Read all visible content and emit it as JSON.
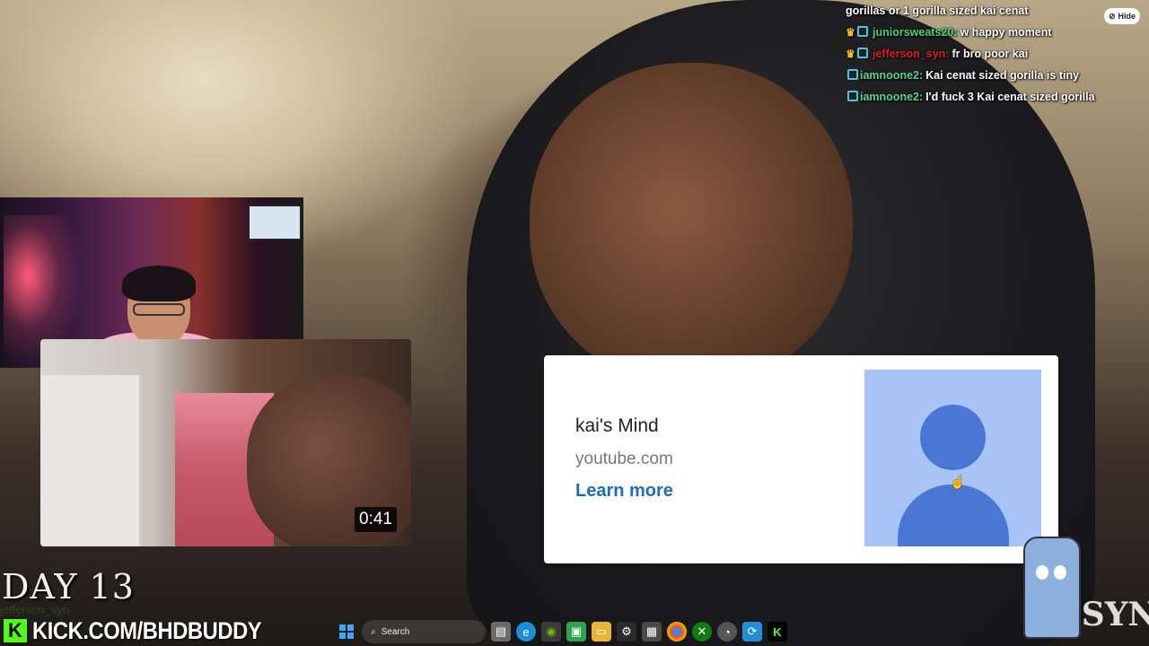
{
  "chat": {
    "first_line": "gorillas or 1 gorilla sized kai cenat",
    "messages": [
      {
        "user": "juniorsweats20:",
        "text": "w happy moment",
        "user_color": "#49d17e",
        "crown": true
      },
      {
        "user": "jefferson_syn:",
        "text": "fr bro poor kai",
        "user_color": "#d9202a",
        "crown": true
      },
      {
        "user": "iamnoone2:",
        "text": "Kai cenat sized gorilla is tiny",
        "user_color": "#56d88a",
        "crown": false
      },
      {
        "user": "iamnoone2:",
        "text": "I'd fuck 3 Kai cenat sized gorilla",
        "user_color": "#56d88a",
        "crown": false
      }
    ],
    "hide_label": "Hide"
  },
  "video_thumb": {
    "duration": "0:41"
  },
  "ad_card": {
    "title": "kai's Mind",
    "site": "youtube.com",
    "cta": "Learn more",
    "accent": "#1e6db8",
    "avatar_bg": "#a8c3f5",
    "avatar_fg": "#4a76d6"
  },
  "overlay": {
    "day": "DAY 13",
    "ghost_name": "jefferson_syn",
    "kick_url": "KICK.COM/BHDBUDDY",
    "kick_color": "#53fc18",
    "logo_text": "SYN"
  },
  "taskbar": {
    "search_label": "Search",
    "icons": [
      "windows-icon",
      "search-icon",
      "widgets-icon",
      "file-explorer-icon",
      "edge-icon",
      "nvidia-icon",
      "app-icon",
      "folder-icon",
      "steam-icon",
      "store-icon",
      "chrome-icon",
      "xbox-icon",
      "app2-icon",
      "app3-icon",
      "kick-icon"
    ]
  }
}
